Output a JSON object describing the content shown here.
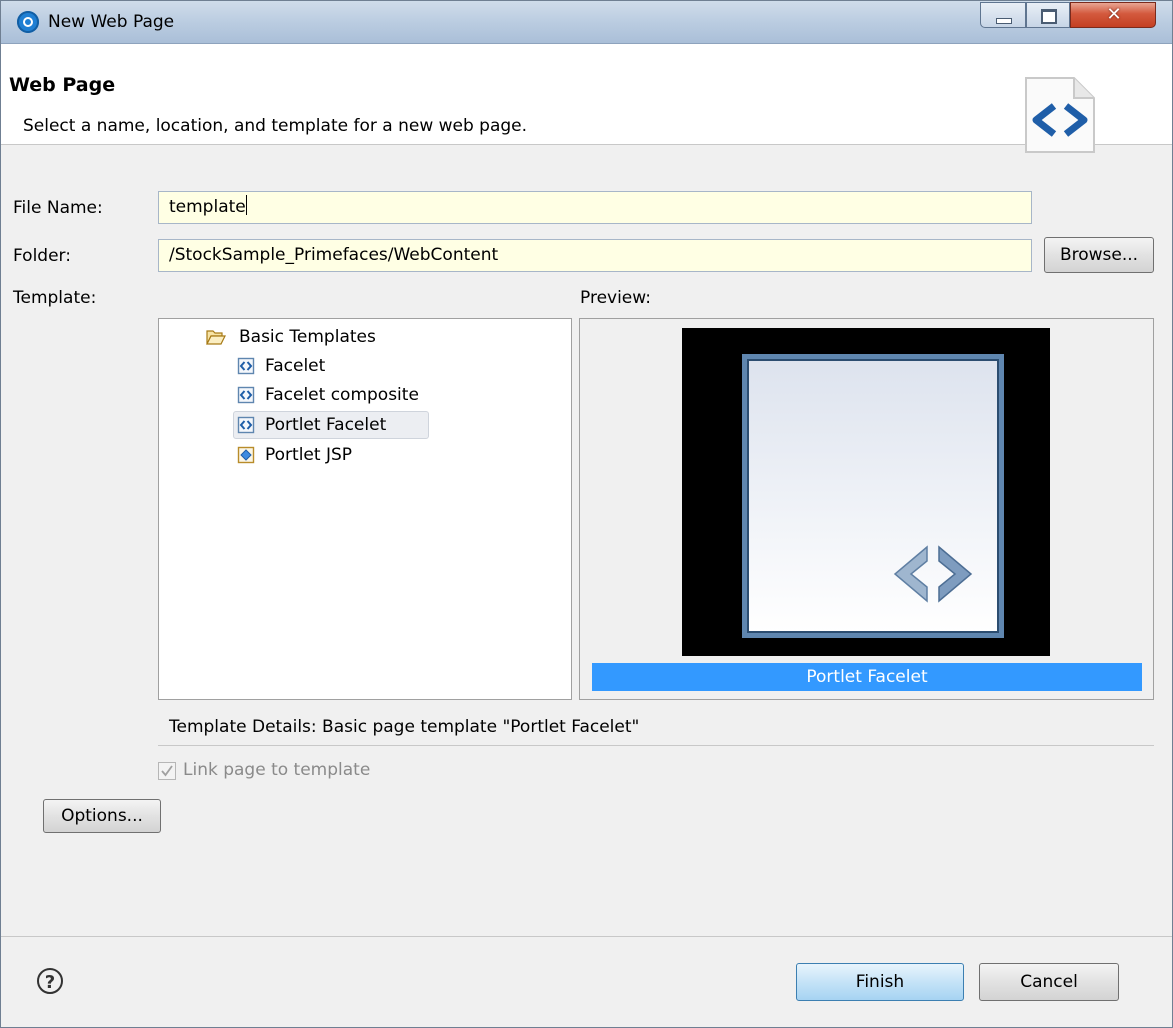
{
  "window": {
    "title": "New Web Page"
  },
  "banner": {
    "title": "Web Page",
    "description": "Select a name, location, and template for a new web page."
  },
  "form": {
    "file_name_label": "File Name:",
    "file_name_value": "template",
    "folder_label": "Folder:",
    "folder_value": "/StockSample_Primefaces/WebContent",
    "browse_label": "Browse...",
    "template_label": "Template:",
    "preview_label": "Preview:"
  },
  "tree": {
    "root": {
      "label": "Basic Templates",
      "icon": "folder-open-icon"
    },
    "items": [
      {
        "label": "Facelet",
        "icon": "facelet-file-icon"
      },
      {
        "label": "Facelet composite",
        "icon": "facelet-file-icon"
      },
      {
        "label": "Portlet Facelet",
        "icon": "facelet-file-icon",
        "selected": true
      },
      {
        "label": "Portlet JSP",
        "icon": "jsp-file-icon"
      }
    ]
  },
  "preview": {
    "caption": "Portlet Facelet"
  },
  "details": {
    "text": "Template Details:  Basic page template \"Portlet Facelet\""
  },
  "link_template": {
    "label": "Link page to template",
    "checked": true,
    "disabled": true
  },
  "buttons": {
    "options": "Options...",
    "finish": "Finish",
    "cancel": "Cancel",
    "help": "?"
  },
  "colors": {
    "selection_blue": "#3399ff",
    "input_bg": "#ffffe4",
    "close_red": "#c43f22"
  }
}
